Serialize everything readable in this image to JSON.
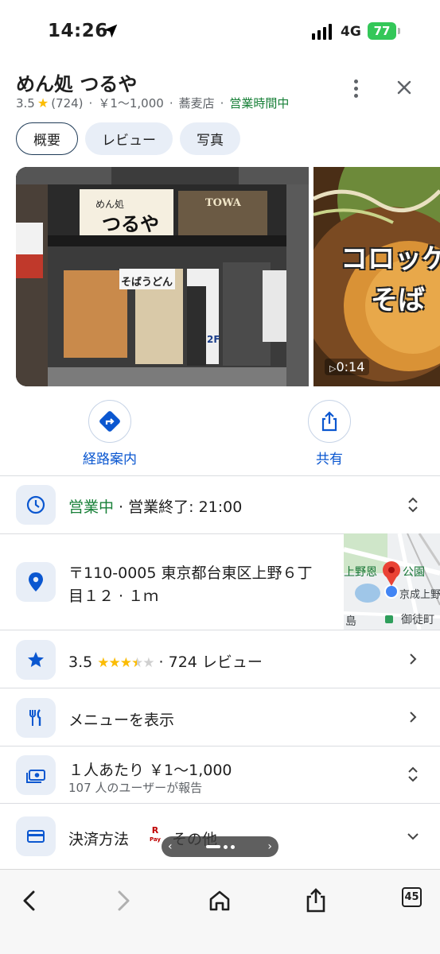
{
  "status": {
    "time": "14:26",
    "network": "4G",
    "battery": "77"
  },
  "place": {
    "title": "めん処 つるや",
    "rating": "3.5",
    "review_count": "(724)",
    "price": "￥1〜1,000",
    "category": "蕎麦店",
    "open_status": "営業時間中",
    "dot": "·"
  },
  "tabs": [
    {
      "label": "概要",
      "active": true
    },
    {
      "label": "レビュー",
      "active": false
    },
    {
      "label": "写真",
      "active": false
    }
  ],
  "photos": {
    "main_sign_1": "めん処",
    "main_sign_2": "つるや",
    "main_sign_3": "TOWA",
    "main_sign_4": "そばうどん",
    "main_sign_5": "2F",
    "second_overlay_1": "コロッケ",
    "second_overlay_2": "そば",
    "video_duration": "0:14"
  },
  "actions": {
    "directions": "経路案内",
    "share": "共有"
  },
  "hours": {
    "status": "営業中",
    "sep": " · ",
    "detail": "営業終了: 21:00"
  },
  "address": {
    "line1": "〒110-0005 東京都台東区上野６丁",
    "line2": "目１２ · １ｍ"
  },
  "map": {
    "label_1": "上野恩",
    "label_2": "公園",
    "label_3": "京成上野",
    "label_4": "御徒町",
    "label_5": "島"
  },
  "reviews_row": {
    "rating": "3.5",
    "count_text": "· 724 レビュー"
  },
  "menu_row": {
    "label": "メニューを表示"
  },
  "price_row": {
    "label": "１人あたり ￥1〜1,000",
    "sub": "107 人のユーザーが報告"
  },
  "payment_row": {
    "label": "決済方法",
    "method": "その他"
  },
  "toolbar": {
    "tabs_count": "45"
  },
  "colors": {
    "accent": "#0b57d0",
    "open_green": "#188038",
    "star": "#fbbc04",
    "icon_bg": "#e8eef7"
  }
}
